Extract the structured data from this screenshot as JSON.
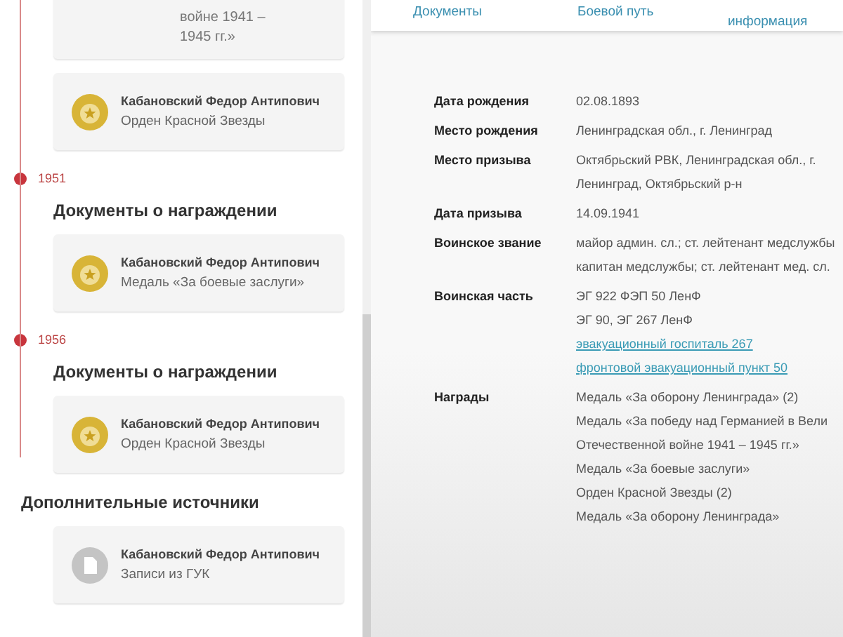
{
  "timeline": {
    "top_card_lines": [
      "войне 1941 –",
      "1945 гг.»"
    ],
    "cards": [
      {
        "kind": "medal",
        "name": "Кабановский Федор Антипович",
        "award": "Орден Красной Звезды"
      }
    ],
    "events": [
      {
        "year": "1951",
        "heading": "Документы о награждении",
        "cards": [
          {
            "kind": "medal",
            "name": "Кабановский Федор Антипович",
            "award": "Медаль «За боевые заслуги»"
          }
        ]
      },
      {
        "year": "1956",
        "heading": "Документы о награждении",
        "cards": [
          {
            "kind": "medal",
            "name": "Кабановский Федор Антипович",
            "award": "Орден Красной Звезды"
          }
        ]
      }
    ]
  },
  "sources": {
    "heading": "Дополнительные источники",
    "cards": [
      {
        "kind": "document",
        "name": "Кабановский Федор Антипович",
        "award": "Записи из ГУК"
      }
    ]
  },
  "tabs": [
    {
      "label": "Документы",
      "selected": false
    },
    {
      "label": "Боевой путь",
      "selected": false
    },
    {
      "label": "информация",
      "selected": false
    }
  ],
  "info": [
    {
      "label": "Дата рождения",
      "lines": [
        {
          "kind": "text",
          "text": "02.08.1893"
        }
      ]
    },
    {
      "label": "Место рождения",
      "lines": [
        {
          "kind": "text",
          "text": "Ленинградская обл., г. Ленинград"
        }
      ]
    },
    {
      "label": "Место призыва",
      "lines": [
        {
          "kind": "text",
          "text": "Октябрьский РВК, Ленинградская обл., г."
        },
        {
          "kind": "text",
          "text": "Ленинград, Октябрьский р-н"
        }
      ]
    },
    {
      "label": "Дата призыва",
      "lines": [
        {
          "kind": "text",
          "text": "14.09.1941"
        }
      ]
    },
    {
      "label": "Воинское звание",
      "lines": [
        {
          "kind": "text",
          "text": "майор админ. сл.; ст. лейтенант медслужбы"
        },
        {
          "kind": "text",
          "text": "капитан медслужбы; ст. лейтенант мед. сл."
        }
      ]
    },
    {
      "label": "Воинская часть",
      "lines": [
        {
          "kind": "text",
          "text": "ЭГ 922 ФЭП 50 ЛенФ"
        },
        {
          "kind": "text",
          "text": "ЭГ 90, ЭГ 267 ЛенФ"
        },
        {
          "kind": "link",
          "text": "эвакуационный госпиталь 267"
        },
        {
          "kind": "link",
          "text": "фронтовой эвакуационный пункт 50"
        }
      ]
    },
    {
      "label": "Награды",
      "lines": [
        {
          "kind": "text",
          "text": "Медаль «За оборону Ленинграда» (2)"
        },
        {
          "kind": "text",
          "text": "Медаль «За победу над Германией в Вели"
        },
        {
          "kind": "text",
          "text": "Отечественной войне 1941 – 1945 гг.»"
        },
        {
          "kind": "text",
          "text": "Медаль «За боевые заслуги»"
        },
        {
          "kind": "text",
          "text": "Орден Красной Звезды (2)"
        },
        {
          "kind": "text",
          "text": "Медаль «За оборону Ленинграда»"
        }
      ]
    }
  ]
}
